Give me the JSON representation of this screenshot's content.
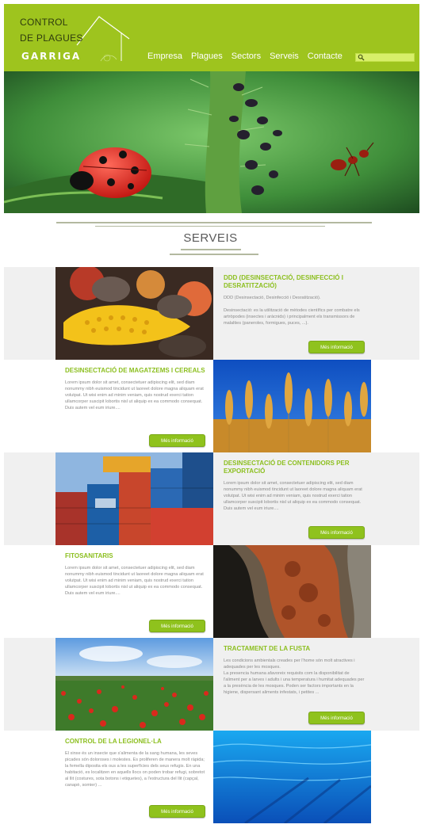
{
  "header": {
    "logo_line1": "CONTROL",
    "logo_line2": "DE PLAGUES",
    "logo_brand": "GARRIGA",
    "nav": [
      "Empresa",
      "Plagues",
      "Sectors",
      "Serveis",
      "Contacte"
    ],
    "search_placeholder": ""
  },
  "section_title": "SERVEIS",
  "colors": {
    "brand_green": "#9ec41e",
    "title_green": "#8cbf1f",
    "button_green": "#8fc21d"
  },
  "services": [
    {
      "title": "DDD (DESINSECTACIÓ, DESINFECCIÓ I DESRATITZACIÓ)",
      "desc": "DDD (Desinsectació, Desinfecció i Desratització).\n\nDesinsectació: es la utilització de mètodes científics per combatre els artròpodes (insectes i aràcnids) i principalment els transmissors de malalties (paneroles, formigues, puces, ...).",
      "button": "Més informació",
      "image_icon": "corn-mice-photo"
    },
    {
      "title": "DESINSECTACIÓ DE MAGATZEMS I CEREALS",
      "desc": "Lorem ipsum dolor sit amet, consectetuer adipiscing elit, sed diam nonummy nibh euismod tincidunt ut laoreet dolore magna aliquam erat volutpat. Ut wisi enim ad minim veniam, quis nostrud exerci tation ullamcorper suscipit lobortis nisl ut aliquip ex ea commodo consequat.\nDuis autem vel eum iriure....",
      "button": "Més informació",
      "image_icon": "wheat-photo"
    },
    {
      "title": "DESINSECTACIÓ DE CONTENIDORS PER EXPORTACIÓ",
      "desc": "Lorem ipsum dolor sit amet, consectetuer adipiscing elit, sed diam nonummy nibh euismod tincidunt ut laoreet dolore magna aliquam erat volutpat. Ut wisi enim ad minim veniam, quis nostrud exerci tation ullamcorper suscipit lobortis nisl ut aliquip ex ea commodo consequat.\nDuis autem vel eum iriure....",
      "button": "Més informació",
      "image_icon": "shipping-containers-photo"
    },
    {
      "title": "FITOSANITARIS",
      "desc": "Lorem ipsum dolor sit amet, consectetuer adipiscing elit, sed diam nonummy nibh euismod tincidunt ut laoreet dolore magna aliquam erat volutpat. Ut wisi enim ad minim veniam, quis nostrud exerci tation ullamcorper suscipit lobortis nisl ut aliquip ex ea commodo consequat.\nDuis autem vel eum iriure....",
      "button": "Més informació",
      "image_icon": "tree-bark-photo"
    },
    {
      "title": "TRACTAMENT DE LA FUSTA",
      "desc": "Les condicions ambientals creades per l'home són molt atractives i adequades per les mosques.\nLa presencia humana afavoreix requisits com la disponibilitat de l'aliment per a larves i adults i una temperatura i humitat adequades per a la presència de les mosques. Poden ser factors importants en la higiene, dispersant aliments infestats, i petites ...",
      "button": "Més informació",
      "image_icon": "poppy-field-photo"
    },
    {
      "title": "CONTROL DE LA LEGIONEL·LA",
      "desc": "El xinxe és un insecte que s'alimenta de la sang humana, les seves picades són doloroses i molestes. Es proliferen de manera molt ràpida; la femella diposita els ous a les superfícies dels seus refugis. En una habitació, es localitzen en aquells llocs on poden trobar refugi, sobretot al llit (costures, sota botons i etiquetes), a l'estructura del llit (capçal, canapè, somier) ...",
      "button": "Més informació",
      "image_icon": "swimming-pool-photo"
    }
  ]
}
